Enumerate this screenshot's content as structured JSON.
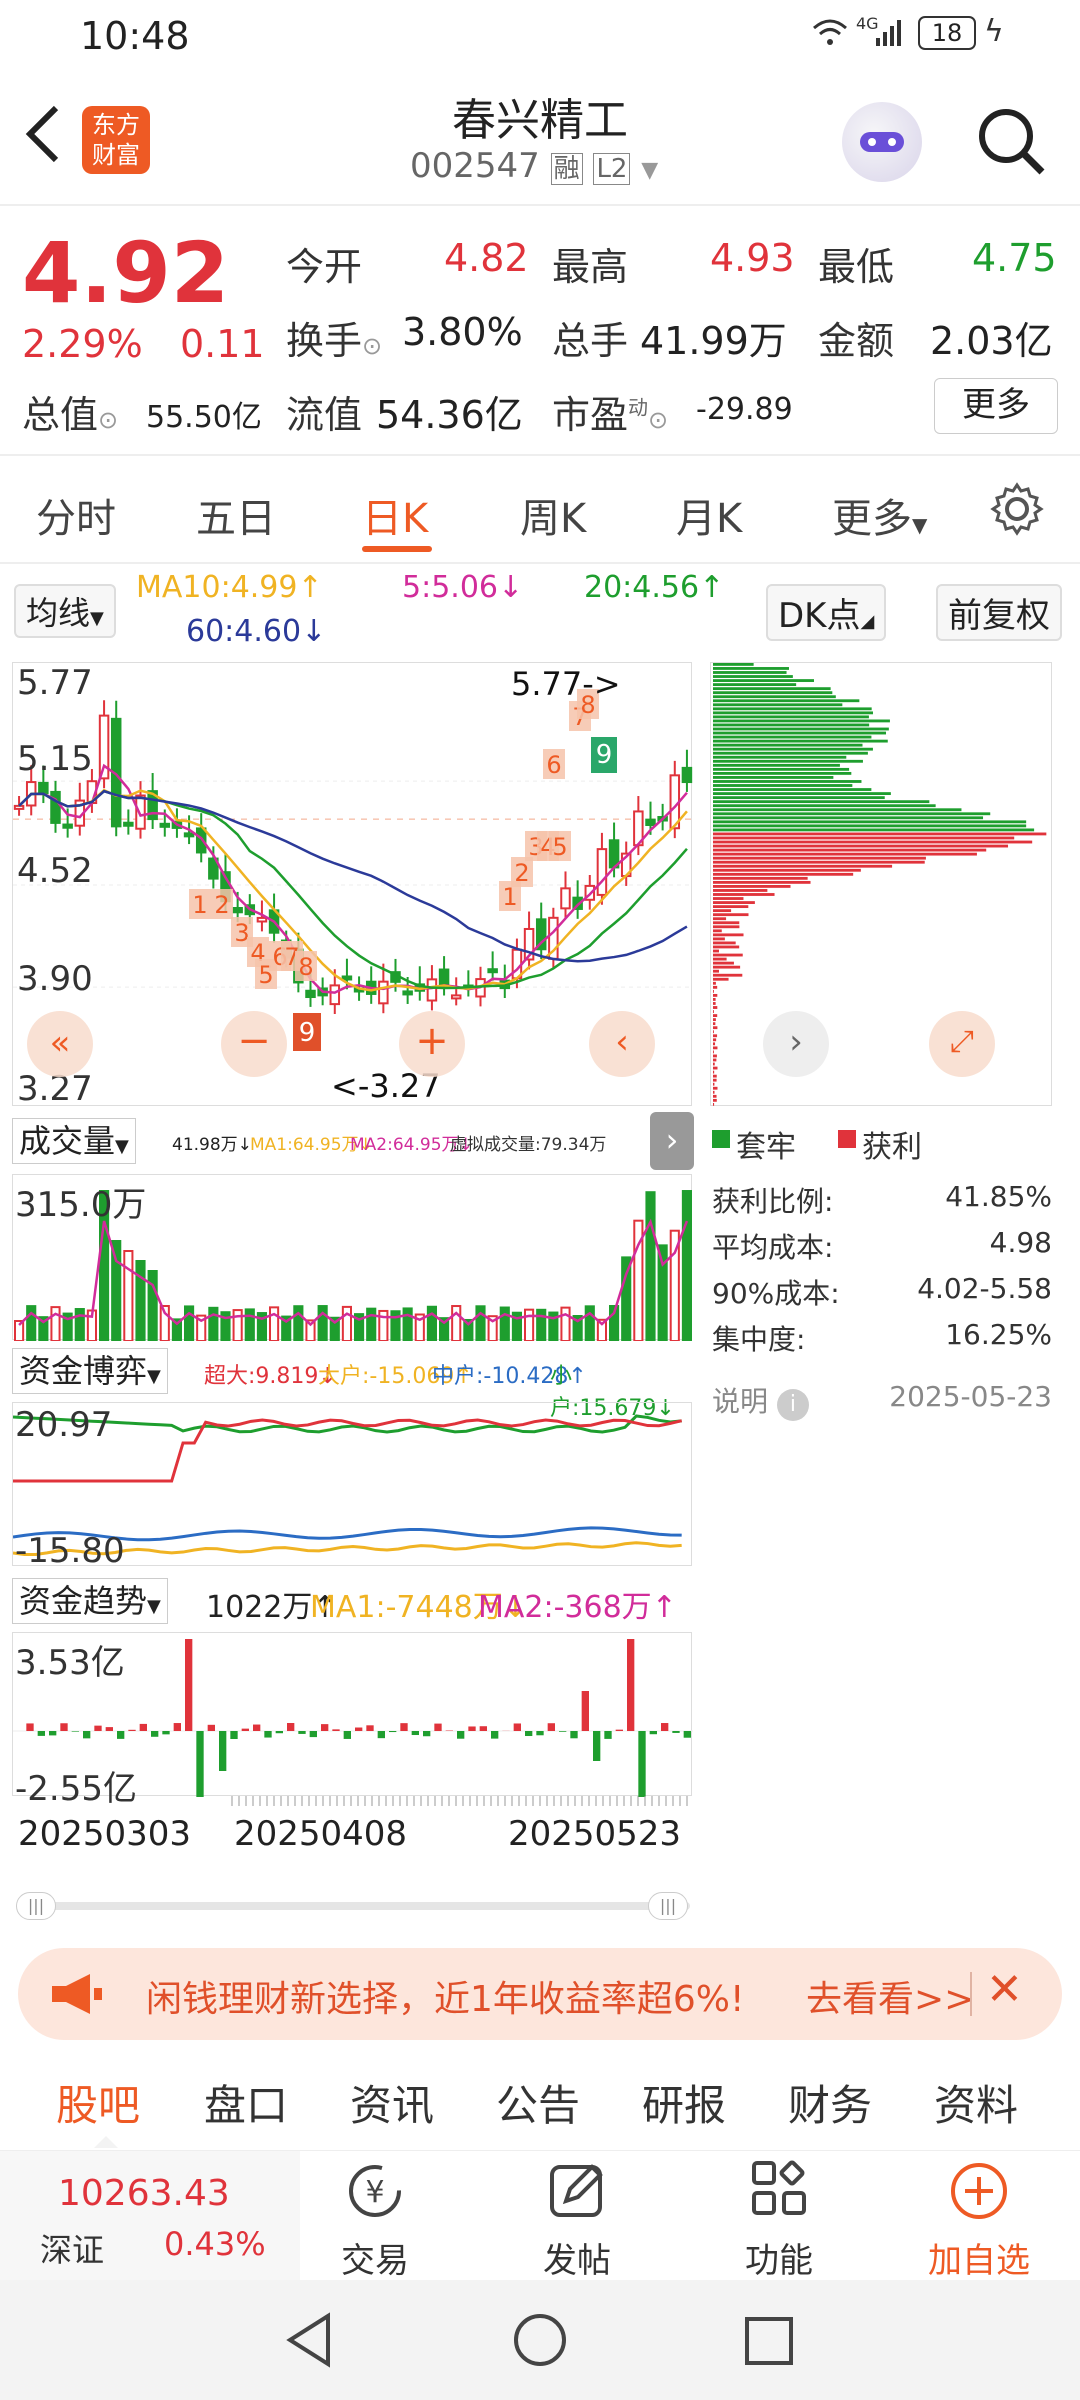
{
  "status": {
    "time": "10:48",
    "signal": "4G",
    "battery": "18"
  },
  "nav": {
    "logo_line1": "东方",
    "logo_line2": "财富",
    "title": "春兴精工",
    "code": "002547",
    "tag_margin": "融",
    "tag_level": "L2"
  },
  "quote": {
    "price": "4.92",
    "change_pct": "2.29%",
    "change": "0.11",
    "open_label": "今开",
    "open": "4.82",
    "high_label": "最高",
    "high": "4.93",
    "low_label": "最低",
    "low": "4.75",
    "turnover_label": "换手",
    "turnover": "3.80%",
    "volume_label": "总手",
    "volume": "41.99万",
    "amount_label": "金额",
    "amount": "2.03亿",
    "mktcap_label": "总值",
    "mktcap": "55.50亿",
    "float_label": "流值",
    "float": "54.36亿",
    "pe_label": "市盈",
    "pe_sup": "动",
    "pe": "-29.89",
    "more_label": "更多"
  },
  "tabs": [
    {
      "label": "分时"
    },
    {
      "label": "五日"
    },
    {
      "label": "日K"
    },
    {
      "label": "周K"
    },
    {
      "label": "月K"
    },
    {
      "label": "更多"
    }
  ],
  "ma": {
    "selector": "均线",
    "ma10": "MA10:4.99↑",
    "ma5": "5:5.06↓",
    "ma20": "20:4.56↑",
    "ma60": "60:4.60↓",
    "dk": "DK点",
    "adjust": "前复权"
  },
  "kchart": {
    "ticks": [
      "5.77",
      "5.15",
      "4.52",
      "3.90",
      "3.27"
    ],
    "high_annot": "5.77->",
    "low_annot": "<-3.27",
    "seq_down": [
      "1",
      "2",
      "3",
      "4",
      "5",
      "6",
      "7",
      "8",
      "9"
    ],
    "seq_up": [
      "1",
      "2",
      "3",
      "4",
      "5",
      "6",
      "7",
      "8",
      "9"
    ]
  },
  "chip": {
    "legend_hold": "套牢",
    "legend_profit": "获利",
    "rows": [
      {
        "label": "获利比例:",
        "value": "41.85%"
      },
      {
        "label": "平均成本:",
        "value": "4.98"
      },
      {
        "label": "90%成本:",
        "value": "4.02-5.58"
      },
      {
        "label": "集中度:",
        "value": "16.25%"
      }
    ],
    "note_label": "说明",
    "date": "2025-05-23"
  },
  "volume": {
    "selector": "成交量",
    "vol": "41.98万↓",
    "ma1": "MA1:64.95万↓",
    "ma2": "MA2:64.95万↓",
    "virtual": "虚拟成交量:79.34万",
    "max": "315.0万"
  },
  "fund_game": {
    "selector": "资金博弈",
    "super": "超大:9.819↓",
    "big": "大户:-15.069↑",
    "mid": "中户:-10.428↑",
    "small": "小户:15.679↓",
    "top": "20.97",
    "bottom": "-15.80"
  },
  "fund_trend": {
    "selector": "资金趋势",
    "val": "1022万↑",
    "ma1": "MA1:-7448万↓",
    "ma2": "MA2:-368万↑",
    "top": "3.53亿",
    "bottom": "-2.55亿"
  },
  "dates": [
    "20250303",
    "20250408",
    "20250523"
  ],
  "ad": {
    "text": "闲钱理财新选择，近1年收益率超6%!",
    "link": "去看看>>"
  },
  "bottom_tabs": [
    "股吧",
    "盘口",
    "资讯",
    "公告",
    "研报",
    "财务",
    "资料"
  ],
  "toolbar": {
    "index_value": "10263.43",
    "index_name": "深证",
    "index_pct": "0.43%",
    "trade": "交易",
    "post": "发帖",
    "func": "功能",
    "add": "加自选"
  },
  "colors": {
    "up": "#e0333b",
    "down": "#1e9e2e",
    "accent": "#ee5a24",
    "ma5": "#d12c9a",
    "ma10": "#f0b323",
    "ma20": "#1e9e2e",
    "ma60": "#2b3a99"
  }
}
